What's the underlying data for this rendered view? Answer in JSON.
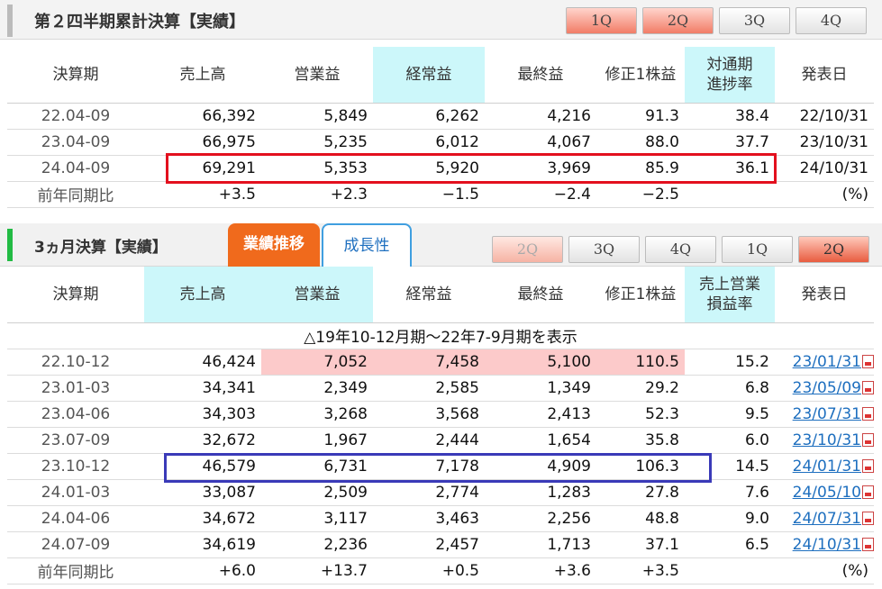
{
  "section1": {
    "title": "第２四半期累計決算【実績】",
    "qtabs": [
      {
        "label": "1Q",
        "state": "on"
      },
      {
        "label": "2Q",
        "state": "on"
      },
      {
        "label": "3Q",
        "state": "off"
      },
      {
        "label": "4Q",
        "state": "off"
      }
    ],
    "headers": [
      "決算期",
      "売上高",
      "営業益",
      "経常益",
      "最終益",
      "修正1株益",
      "対通期\n進捗率",
      "発表日"
    ],
    "rows": [
      {
        "period": "22.04-09",
        "sales": "66,392",
        "op": "5,849",
        "ord": "6,262",
        "net": "4,216",
        "eps": "91.3",
        "ratio": "38.4",
        "date": "22/10/31"
      },
      {
        "period": "23.04-09",
        "sales": "66,975",
        "op": "5,235",
        "ord": "6,012",
        "net": "4,067",
        "eps": "88.0",
        "ratio": "37.7",
        "date": "23/10/31"
      },
      {
        "period": "24.04-09",
        "sales": "69,291",
        "op": "5,353",
        "ord": "5,920",
        "net": "3,969",
        "eps": "85.9",
        "ratio": "36.1",
        "date": "24/10/31"
      }
    ],
    "yoy": {
      "label": "前年同期比",
      "sales": "+3.5",
      "op": "+2.3",
      "ord": "−1.5",
      "net": "−2.4",
      "eps": "−2.5",
      "ratio": "",
      "unit": "(%)"
    }
  },
  "section2": {
    "title": "3ヵ月決算【実績】",
    "ftabs": [
      {
        "label": "業績推移",
        "active": true
      },
      {
        "label": "成長性",
        "active": false
      }
    ],
    "qtabs": [
      {
        "label": "2Q",
        "state": "partial"
      },
      {
        "label": "3Q",
        "state": "off"
      },
      {
        "label": "4Q",
        "state": "off"
      },
      {
        "label": "1Q",
        "state": "normal"
      },
      {
        "label": "2Q",
        "state": "on-dark"
      }
    ],
    "headers": [
      "決算期",
      "売上高",
      "営業益",
      "経常益",
      "最終益",
      "修正1株益",
      "売上営業\n損益率",
      "発表日"
    ],
    "note": "△19年10-12月期～22年7-9月期を表示",
    "rows": [
      {
        "period": "22.10-12",
        "sales": "46,424",
        "op": "7,052",
        "ord": "7,458",
        "net": "5,100",
        "eps": "110.5",
        "ratio": "15.2",
        "date": "23/01/31",
        "pink": true
      },
      {
        "period": "23.01-03",
        "sales": "34,341",
        "op": "2,349",
        "ord": "2,585",
        "net": "1,349",
        "eps": "29.2",
        "ratio": "6.8",
        "date": "23/05/09",
        "pink": false
      },
      {
        "period": "23.04-06",
        "sales": "34,303",
        "op": "3,268",
        "ord": "3,568",
        "net": "2,413",
        "eps": "52.3",
        "ratio": "9.5",
        "date": "23/07/31",
        "pink": false
      },
      {
        "period": "23.07-09",
        "sales": "32,672",
        "op": "1,967",
        "ord": "2,444",
        "net": "1,654",
        "eps": "35.8",
        "ratio": "6.0",
        "date": "23/10/31",
        "pink": false
      },
      {
        "period": "23.10-12",
        "sales": "46,579",
        "op": "6,731",
        "ord": "7,178",
        "net": "4,909",
        "eps": "106.3",
        "ratio": "14.5",
        "date": "24/01/31",
        "pink": false
      },
      {
        "period": "24.01-03",
        "sales": "33,087",
        "op": "2,509",
        "ord": "2,774",
        "net": "1,283",
        "eps": "27.8",
        "ratio": "7.6",
        "date": "24/05/10",
        "pink": false
      },
      {
        "period": "24.04-06",
        "sales": "34,672",
        "op": "3,117",
        "ord": "3,463",
        "net": "2,256",
        "eps": "48.8",
        "ratio": "9.0",
        "date": "24/07/31",
        "pink": false
      },
      {
        "period": "24.07-09",
        "sales": "34,619",
        "op": "2,236",
        "ord": "2,457",
        "net": "1,713",
        "eps": "37.1",
        "ratio": "6.5",
        "date": "24/10/31",
        "pink": false
      }
    ],
    "yoy": {
      "label": "前年同期比",
      "sales": "+6.0",
      "op": "+13.7",
      "ord": "+0.5",
      "net": "+3.6",
      "eps": "+3.5",
      "ratio": "",
      "unit": "(%)"
    }
  },
  "colors": {
    "highlight_red_box": "#e3101e",
    "highlight_blue_box": "#3a3ab8",
    "header_cyan": "#ccf7fa",
    "positive": "#ff2a00",
    "negative": "#0d5ec9"
  }
}
